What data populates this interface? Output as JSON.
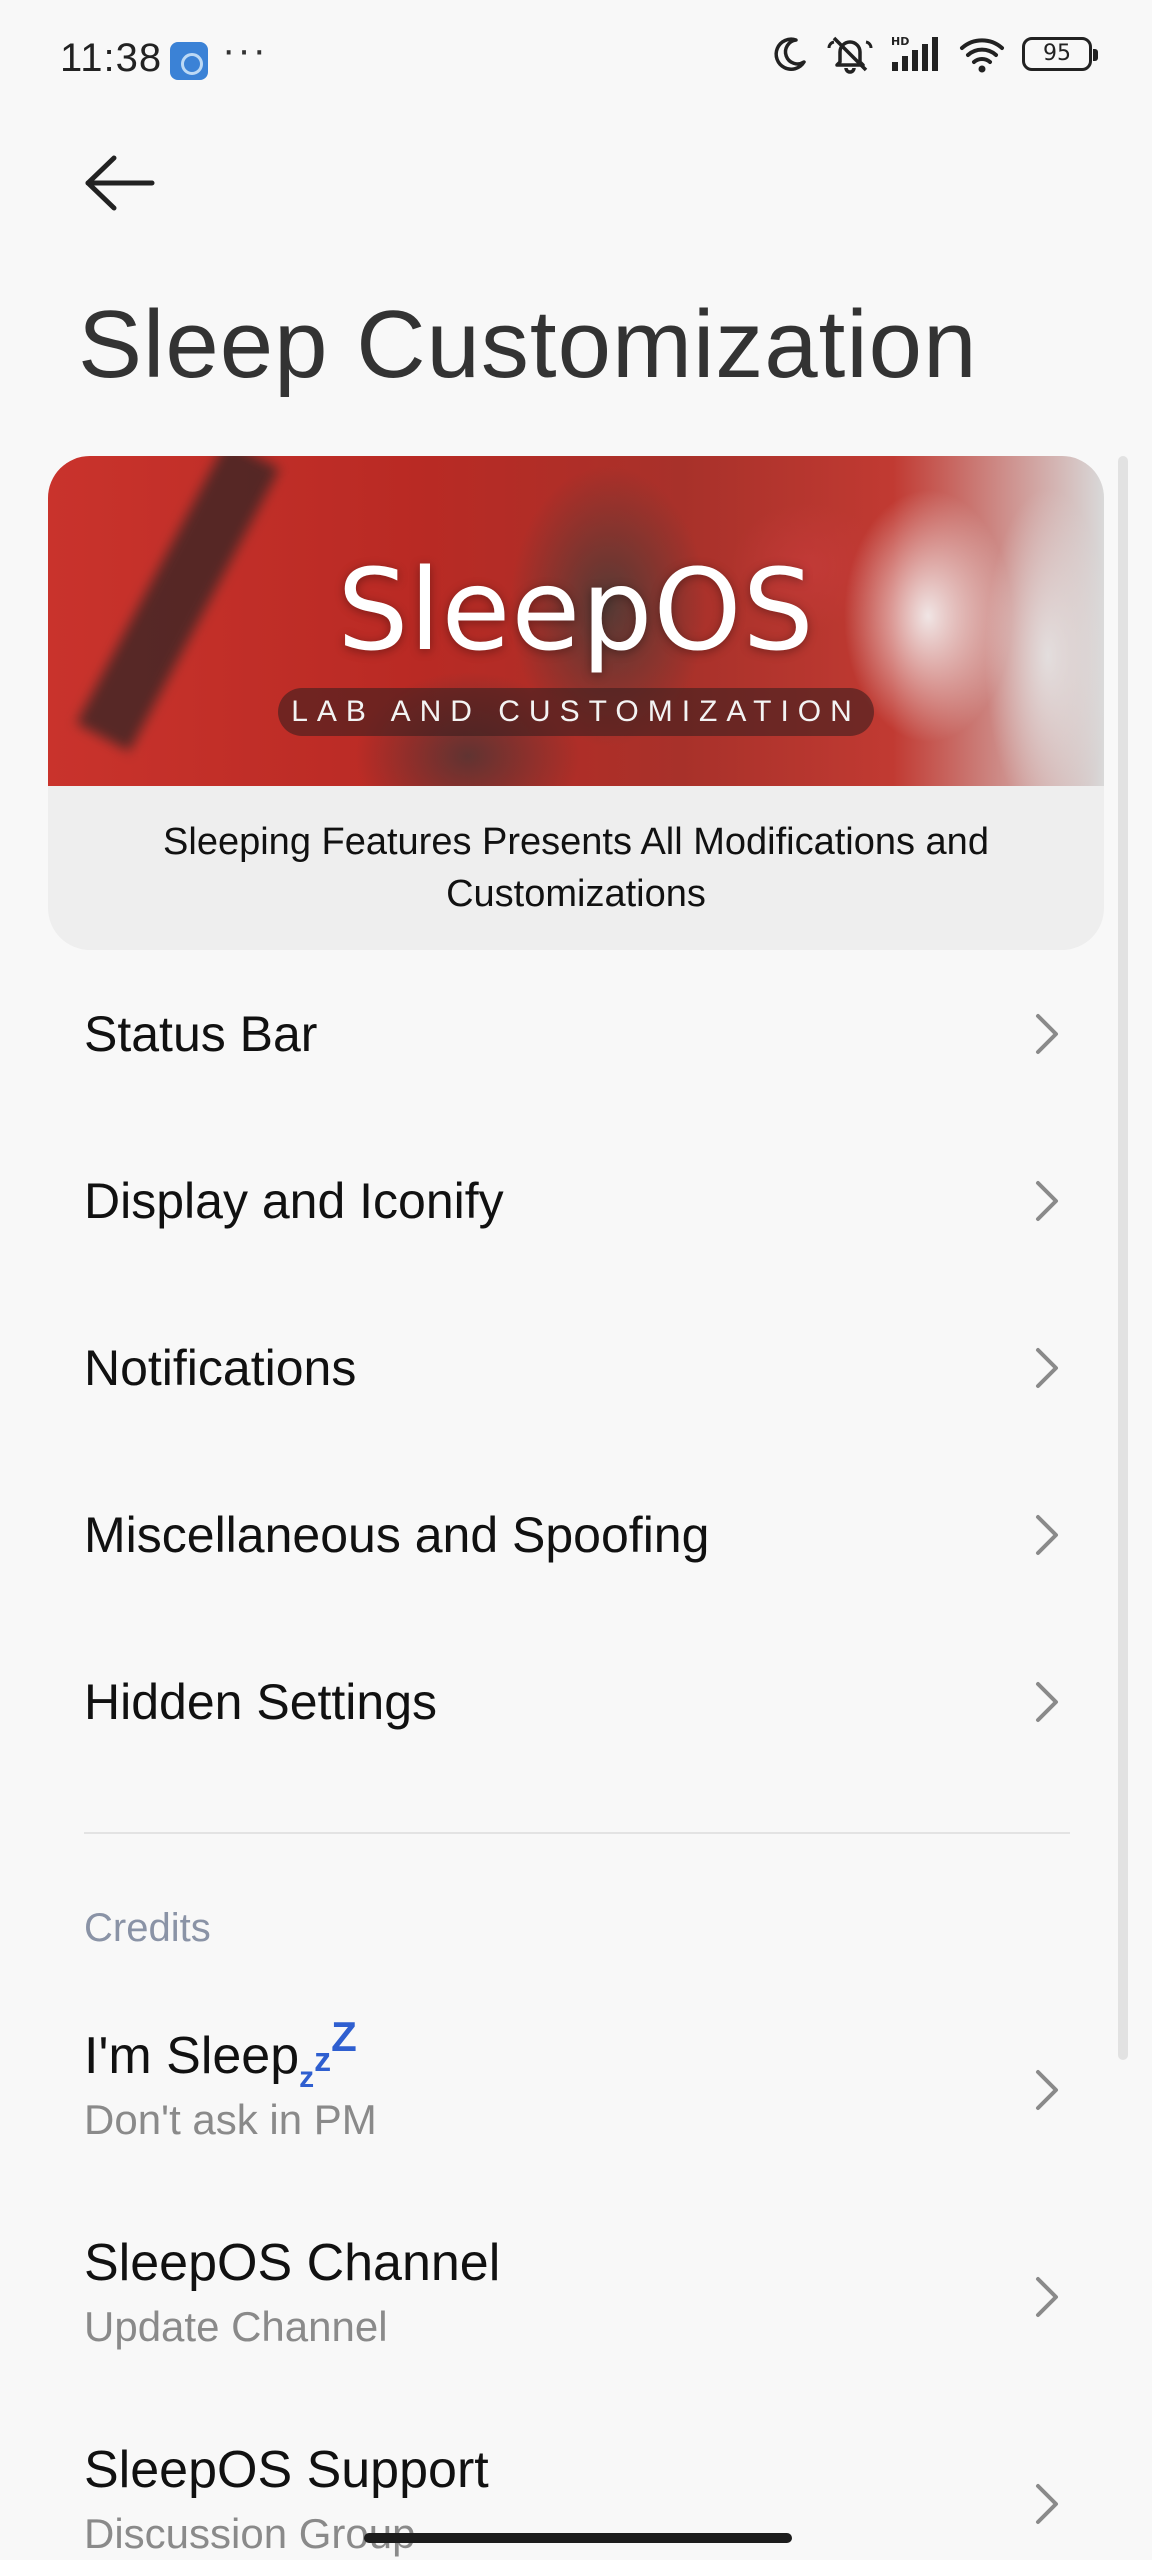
{
  "status_bar": {
    "time": "11:38",
    "more": "···",
    "battery_level": "95",
    "icons": [
      "app-notification-icon",
      "moon-icon",
      "bell-off-icon",
      "hd-signal-icon",
      "wifi-icon",
      "battery-icon"
    ]
  },
  "header": {
    "back_icon": "arrow-left-icon",
    "title": "Sleep Customization"
  },
  "banner": {
    "logo_text": "SleepOS",
    "tagline": "LAB AND CUSTOMIZATION",
    "caption": "Sleeping Features Presents All Modifications and Customizations"
  },
  "menu": {
    "items": [
      {
        "label": "Status Bar"
      },
      {
        "label": "Display and Iconify"
      },
      {
        "label": "Notifications"
      },
      {
        "label": "Miscellaneous and Spoofing"
      },
      {
        "label": "Hidden Settings"
      }
    ]
  },
  "credits": {
    "header": "Credits",
    "items": [
      {
        "title": "I'm Sleep",
        "title_suffix": [
          "z",
          "z",
          "Z"
        ],
        "subtitle": "Don't ask in PM"
      },
      {
        "title": "SleepOS Channel",
        "subtitle": "Update Channel"
      },
      {
        "title": "SleepOS Support",
        "subtitle": "Discussion Group"
      }
    ]
  },
  "colors": {
    "background": "#f8f8f8",
    "section_header": "#8a93a6",
    "zzz_accent": "#2f5fd0",
    "banner_red": "#c9332c"
  }
}
